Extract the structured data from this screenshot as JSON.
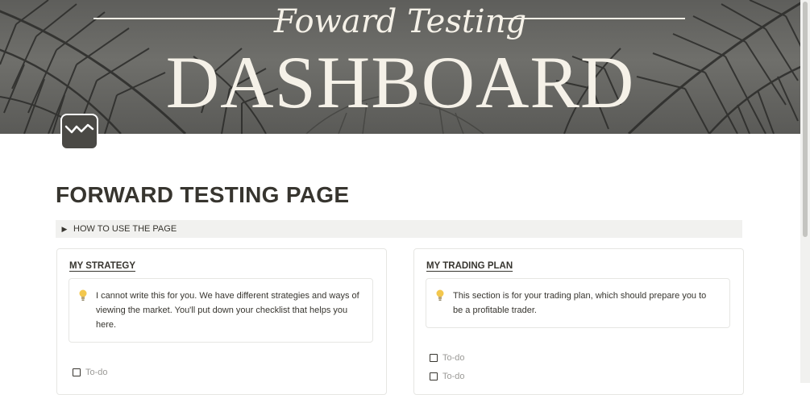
{
  "cover": {
    "script_text": "Foward Testing",
    "title_text": "DASHBOARD"
  },
  "page": {
    "icon": "chart-check-icon",
    "title": "FORWARD TESTING PAGE"
  },
  "toggle": {
    "label": "HOW TO USE THE PAGE"
  },
  "cards": [
    {
      "heading": "MY STRATEGY",
      "callout_icon": "lightbulb-icon",
      "callout_text": "I cannot write this for you. We have different strategies and ways of viewing the market. You'll put down your checklist that helps you here.",
      "todos": [
        "To-do"
      ]
    },
    {
      "heading": "MY TRADING PLAN",
      "callout_icon": "lightbulb-icon",
      "callout_text": "This section is for your trading plan, which should prepare you to be a profitable trader.",
      "todos": [
        "To-do",
        "To-do"
      ]
    }
  ],
  "colors": {
    "text": "#37352f",
    "placeholder": "#9b9a97",
    "toggle_bg": "#f1f1ef",
    "cover_text": "#f5f1e8",
    "bulb": "#f3c74d"
  }
}
